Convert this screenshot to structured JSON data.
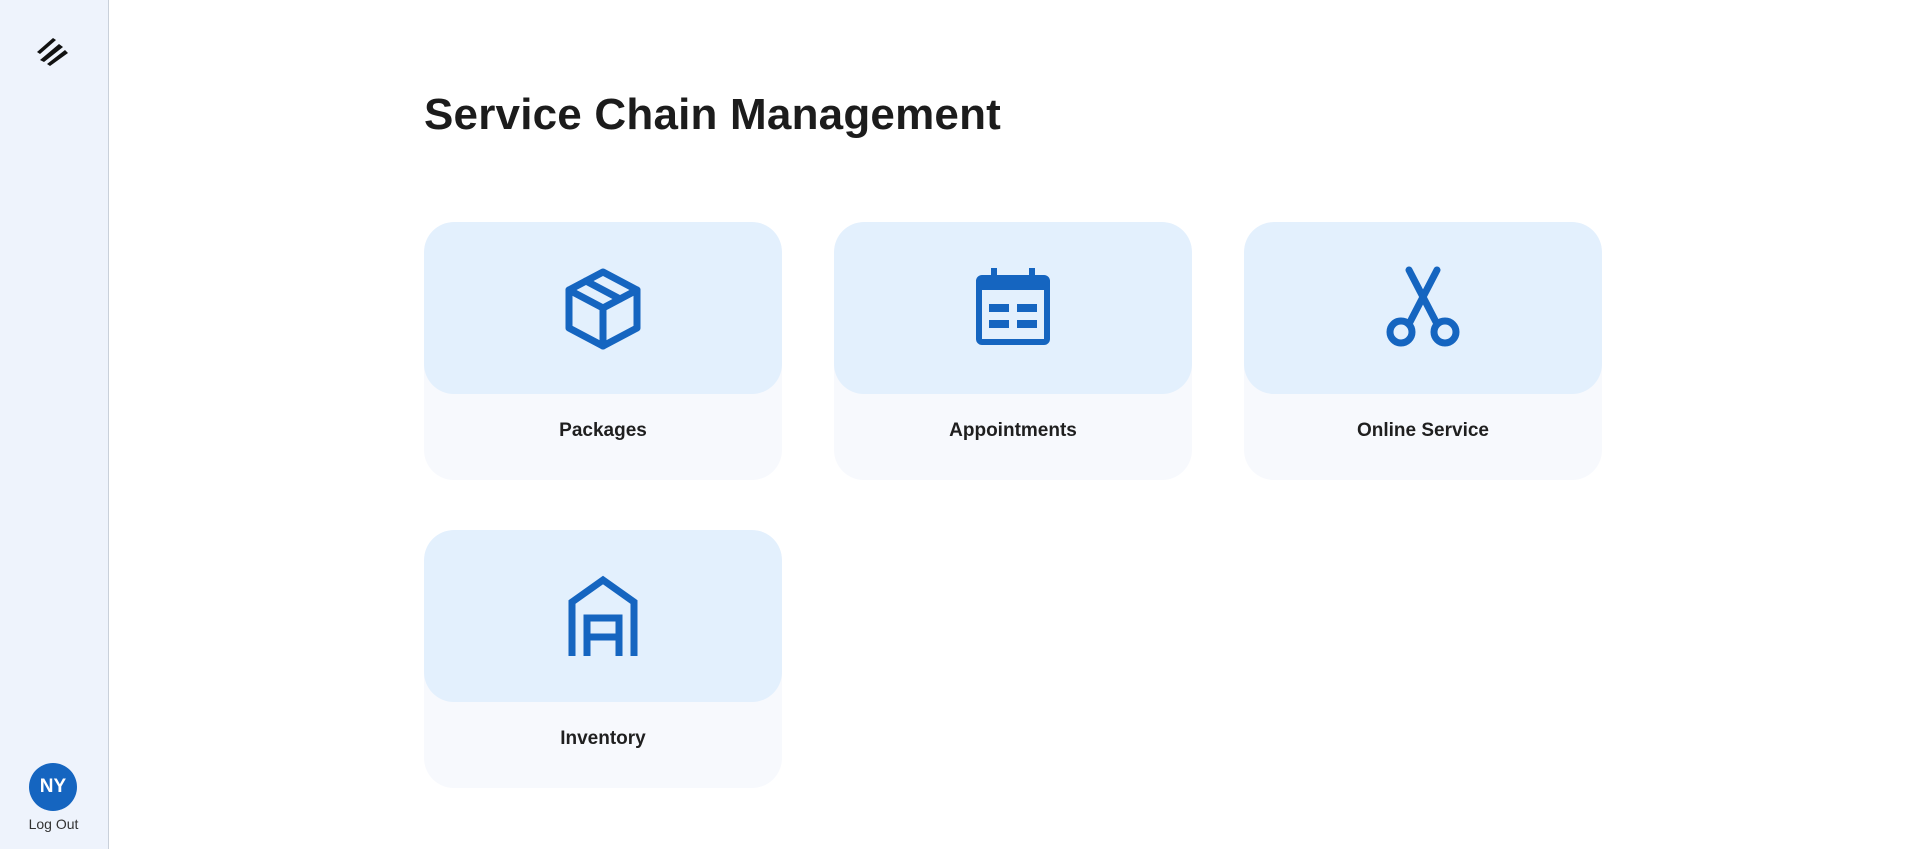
{
  "sidebar": {
    "logo_icon": "feather-logo-icon",
    "user": {
      "initials": "NY",
      "logout_label": "Log Out"
    }
  },
  "page": {
    "title": "Service Chain Management"
  },
  "colors": {
    "accent": "#1565c0",
    "card_icon_bg": "#e3f0fd",
    "card_bg": "#f7f9fd",
    "sidebar_bg": "#eef3fc"
  },
  "cards": [
    {
      "label": "Packages",
      "icon": "package-box-icon"
    },
    {
      "label": "Appointments",
      "icon": "calendar-icon"
    },
    {
      "label": "Online Service",
      "icon": "scissors-icon"
    },
    {
      "label": "Inventory",
      "icon": "warehouse-icon"
    }
  ]
}
